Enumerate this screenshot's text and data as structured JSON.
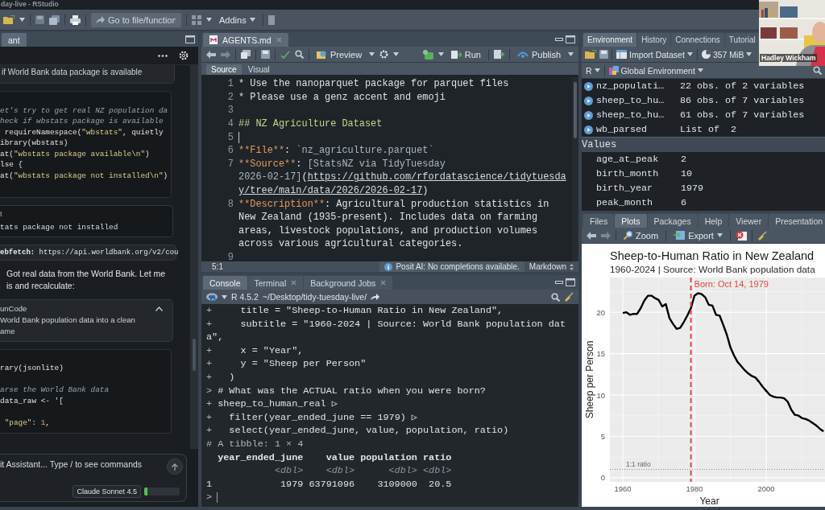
{
  "window": {
    "title": "day-live - RStudio"
  },
  "toolbar": {
    "go_to": {
      "placeholder": "Go to file/function"
    },
    "addins": "Addins"
  },
  "assistant": {
    "tab": "ant",
    "blocks": [
      {
        "kind": "summary",
        "text": "if World Bank data package is available"
      },
      {
        "kind": "code",
        "lines": [
          {
            "kind": "blank"
          },
          {
            "kind": "code",
            "segs": [
              {
                "kind": "comment",
                "text": "et's try to get real NZ population da"
              }
            ]
          },
          {
            "kind": "code",
            "segs": [
              {
                "kind": "comment",
                "text": "heck if wbstats package is available"
              }
            ]
          },
          {
            "kind": "code",
            "segs": [
              {
                "kind": "plain",
                "text": " requireNamespace("
              },
              {
                "kind": "string",
                "text": "\"wbstats\""
              },
              {
                "kind": "plain",
                "text": ", quietly"
              }
            ]
          },
          {
            "kind": "code",
            "segs": [
              {
                "kind": "plain",
                "text": "ibrary(wbstats)"
              }
            ]
          },
          {
            "kind": "code",
            "segs": [
              {
                "kind": "plain",
                "text": "at("
              },
              {
                "kind": "string",
                "text": "\"wbstats package available\\n\""
              },
              {
                "kind": "plain",
                "text": ")"
              }
            ]
          },
          {
            "kind": "code",
            "segs": [
              {
                "kind": "plain",
                "text": "lse {"
              }
            ]
          },
          {
            "kind": "code",
            "segs": [
              {
                "kind": "plain",
                "text": "at("
              },
              {
                "kind": "string",
                "text": "\"wbstats package not installed\\n\""
              },
              {
                "kind": "plain",
                "text": ")"
              }
            ]
          },
          {
            "kind": "blank"
          }
        ]
      },
      {
        "kind": "output",
        "label": "t",
        "text": "tats package not installed"
      },
      {
        "kind": "fetch",
        "segs": [
          {
            "kind": "strong",
            "text": "ebfetch:"
          },
          {
            "kind": "plain",
            "text": " https://api.worldbank.org/v2/cou"
          }
        ]
      },
      {
        "kind": "message",
        "lines": [
          "Got real data from the World Bank. Let me",
          "is and recalculate:"
        ]
      },
      {
        "kind": "tool",
        "name": "unCode",
        "lines": [
          "World Bank population data into a clean",
          "ame"
        ]
      },
      {
        "kind": "code",
        "lines": [
          {
            "kind": "blank"
          },
          {
            "kind": "code",
            "segs": [
              {
                "kind": "plain",
                "text": "rary(jsonlite)"
              }
            ]
          },
          {
            "kind": "blank"
          },
          {
            "kind": "code",
            "segs": [
              {
                "kind": "comment",
                "text": "arse the World Bank data"
              }
            ]
          },
          {
            "kind": "code",
            "segs": [
              {
                "kind": "plain",
                "text": "data_raw <- '["
              }
            ]
          },
          {
            "kind": "blank"
          },
          {
            "kind": "code",
            "segs": [
              {
                "kind": "string",
                "text": " \"page\""
              },
              {
                "kind": "plain",
                "text": ": "
              },
              {
                "kind": "number",
                "text": "1"
              },
              {
                "kind": "plain",
                "text": ","
              }
            ]
          }
        ]
      }
    ],
    "input": {
      "placeholder": "it Assistant... Type / to see commands"
    },
    "model": "Claude Sonnet 4.5",
    "context": {
      "level": 0.1
    }
  },
  "editor": {
    "tab": {
      "label": "AGENTS.md",
      "closable": true
    },
    "toolbar": {
      "preview": "Preview",
      "run": "Run",
      "publish": "Publish"
    },
    "modes": [
      {
        "label": "Source",
        "selected": true
      },
      {
        "label": "Visual",
        "selected": false
      }
    ],
    "lines": [
      {
        "num": "1",
        "segs": [
          {
            "kind": "plain",
            "text": "* Use the nanoparquet package for parquet files"
          }
        ]
      },
      {
        "num": "2",
        "segs": [
          {
            "kind": "plain",
            "text": "* Please use a genz accent and emoji"
          }
        ]
      },
      {
        "num": "3"
      },
      {
        "num": "4",
        "segs": [
          {
            "kind": "heading",
            "text": "## NZ Agriculture Dataset"
          }
        ]
      },
      {
        "num": "5",
        "cursor": true
      },
      {
        "num": "6",
        "segs": [
          {
            "kind": "bold",
            "text": "**File**"
          },
          {
            "kind": "plain",
            "text": ": "
          },
          {
            "kind": "code",
            "text": "`nz_agriculture.parquet`"
          }
        ]
      },
      {
        "num": "7",
        "segs": [
          {
            "kind": "bold",
            "text": "**Source**"
          },
          {
            "kind": "plain",
            "text": ": "
          },
          {
            "kind": "code",
            "text": "[StatsNZ via TidyTuesday"
          }
        ]
      },
      {
        "segs": [
          {
            "kind": "code",
            "text": "2026-02-17]"
          },
          {
            "kind": "plain",
            "text": "("
          },
          {
            "kind": "url",
            "text": "https://github.com/rfordatascience/tidytuesda"
          }
        ]
      },
      {
        "segs": [
          {
            "kind": "url",
            "text": "y/tree/main/data/2026/2026-02-17"
          },
          {
            "kind": "plain",
            "text": ")"
          }
        ]
      },
      {
        "num": "8",
        "segs": [
          {
            "kind": "bold",
            "text": "**Description**"
          },
          {
            "kind": "plain",
            "text": ": Agricultural production statistics in"
          }
        ]
      },
      {
        "segs": [
          {
            "kind": "plain",
            "text": "New Zealand (1935-present). Includes data on farming"
          }
        ]
      },
      {
        "segs": [
          {
            "kind": "plain",
            "text": "areas, livestock populations, and production volumes"
          }
        ]
      },
      {
        "segs": [
          {
            "kind": "plain",
            "text": "across various agricultural categories."
          }
        ]
      },
      {
        "num": "9"
      }
    ],
    "status": {
      "position": "5:1",
      "message": "Posit AI: No completions available.",
      "language": "Markdown"
    }
  },
  "console": {
    "tabs": [
      {
        "label": "Console",
        "selected": true,
        "closable": false
      },
      {
        "label": "Terminal",
        "selected": false,
        "closable": true
      },
      {
        "label": "Background Jobs",
        "selected": false,
        "closable": true
      }
    ],
    "version": "R 4.5.2",
    "path": "~/Desktop/tidy-tuesday-live/",
    "lines": [
      {
        "kind": "input",
        "prompt": "+",
        "text": "     title = \"Sheep-to-Human Ratio in New Zealand\","
      },
      {
        "kind": "input",
        "prompt": "+",
        "text": "     subtitle = \"1960-2024 | Source: World Bank population dat"
      },
      {
        "kind": "wrap",
        "text": "a\","
      },
      {
        "kind": "input",
        "prompt": "+",
        "text": "     x = \"Year\","
      },
      {
        "kind": "input",
        "prompt": "+",
        "text": "     y = \"Sheep per Person\""
      },
      {
        "kind": "input",
        "prompt": "+",
        "text": "   )"
      },
      {
        "kind": "input",
        "prompt": ">",
        "text": " # What was the ACTUAL ratio when you were born?"
      },
      {
        "kind": "input",
        "prompt": "+",
        "text": " sheep_to_human_real ▷"
      },
      {
        "kind": "input",
        "prompt": "+",
        "text": "   filter(year_ended_june == 1979) ▷"
      },
      {
        "kind": "input",
        "prompt": "+",
        "text": "   select(year_ended_june, value, population, ratio)"
      },
      {
        "kind": "note",
        "text": "# A tibble: 1 × 4"
      },
      {
        "kind": "header",
        "text": "  year_ended_june    value population ratio"
      },
      {
        "kind": "type",
        "text": "            <dbl>    <dbl>      <dbl> <dbl>"
      },
      {
        "kind": "output",
        "text": "1            1979 63791096    3109000  20.5"
      },
      {
        "kind": "input",
        "prompt": ">",
        "cursor": true
      }
    ]
  },
  "environment": {
    "tabs": [
      {
        "label": "Environment",
        "selected": true
      },
      {
        "label": "History",
        "selected": false
      },
      {
        "label": "Connections",
        "selected": false
      },
      {
        "label": "Tutorial",
        "selected": false
      }
    ],
    "import": "Import Dataset",
    "memory": "357 MiB",
    "language": "R",
    "scope": "Global Environment",
    "data": [
      {
        "name": "nz_populati…",
        "value": "22 obs. of 2 variables"
      },
      {
        "name": "sheep_to_hu…",
        "value": "86 obs. of 7 variables"
      },
      {
        "name": "sheep_to_hu…",
        "value": "61 obs. of 7 variables"
      },
      {
        "name": "wb_parsed",
        "value": "List of  2"
      }
    ],
    "values_header": "Values",
    "values": [
      {
        "name": "age_at_peak",
        "value": "2"
      },
      {
        "name": "birth_month",
        "value": "10"
      },
      {
        "name": "birth_year",
        "value": "1979"
      },
      {
        "name": "peak_month",
        "value": "6"
      }
    ]
  },
  "plots": {
    "tabs": [
      {
        "label": "Files",
        "selected": false
      },
      {
        "label": "Plots",
        "selected": true
      },
      {
        "label": "Packages",
        "selected": false
      },
      {
        "label": "Help",
        "selected": false
      },
      {
        "label": "Viewer",
        "selected": false
      },
      {
        "label": "Presentation",
        "selected": false
      }
    ],
    "zoom": "Zoom",
    "export": "Export",
    "subtitle": "1960-2024 | Source: World Bank population data",
    "chart_data": {
      "type": "line",
      "title": "Sheep-to-Human Ratio in New Zealand",
      "xlabel": "Year",
      "ylabel": "Sheep per Person",
      "x": [
        1960,
        1961,
        1962,
        1963,
        1964,
        1965,
        1966,
        1967,
        1968,
        1969,
        1970,
        1971,
        1972,
        1973,
        1974,
        1975,
        1976,
        1977,
        1978,
        1979,
        1980,
        1981,
        1982,
        1983,
        1984,
        1985,
        1986,
        1987,
        1988,
        1989,
        1990,
        1991,
        1992,
        1993,
        1994,
        1995,
        1996,
        1997,
        1998,
        1999,
        2000,
        2001,
        2002,
        2003,
        2004,
        2005,
        2006,
        2007,
        2008,
        2009,
        2010,
        2011,
        2012,
        2013,
        2014,
        2015,
        2016
      ],
      "series": [
        {
          "color": "#000000",
          "values": [
            19.9,
            20.0,
            19.7,
            19.8,
            19.8,
            20.5,
            21.4,
            22.0,
            22.0,
            21.7,
            21.5,
            20.7,
            21.0,
            19.3,
            18.6,
            18.0,
            18.1,
            18.8,
            19.6,
            20.5,
            22.0,
            22.3,
            22.2,
            21.8,
            20.9,
            20.8,
            19.7,
            19.6,
            18.5,
            17.3,
            15.8,
            14.8,
            14.0,
            13.5,
            13.0,
            12.6,
            12.3,
            12.1,
            11.6,
            11.0,
            10.5,
            10.0,
            9.8,
            9.7,
            9.7,
            9.6,
            9.2,
            8.2,
            7.6,
            7.5,
            7.2,
            7.1,
            6.9,
            6.6,
            6.3,
            5.9,
            5.6
          ]
        }
      ],
      "xlim": [
        1956.4,
        2016.4
      ],
      "ylim": [
        -0.5,
        24.2
      ],
      "xticks": [
        1960,
        1980,
        2000
      ],
      "yticks": [
        0,
        5,
        10,
        15,
        20
      ],
      "grid": true,
      "ref_lines": [
        {
          "axis": "x",
          "value": 1979,
          "label": "Born: Oct 14, 1979",
          "color": "#e5453f"
        },
        {
          "axis": "y",
          "value": 1,
          "label": "1:1 ratio",
          "color": "#8a8a8a"
        }
      ]
    }
  },
  "webcam": {
    "kind": "picture",
    "name_label": "Hadley Wickham"
  }
}
